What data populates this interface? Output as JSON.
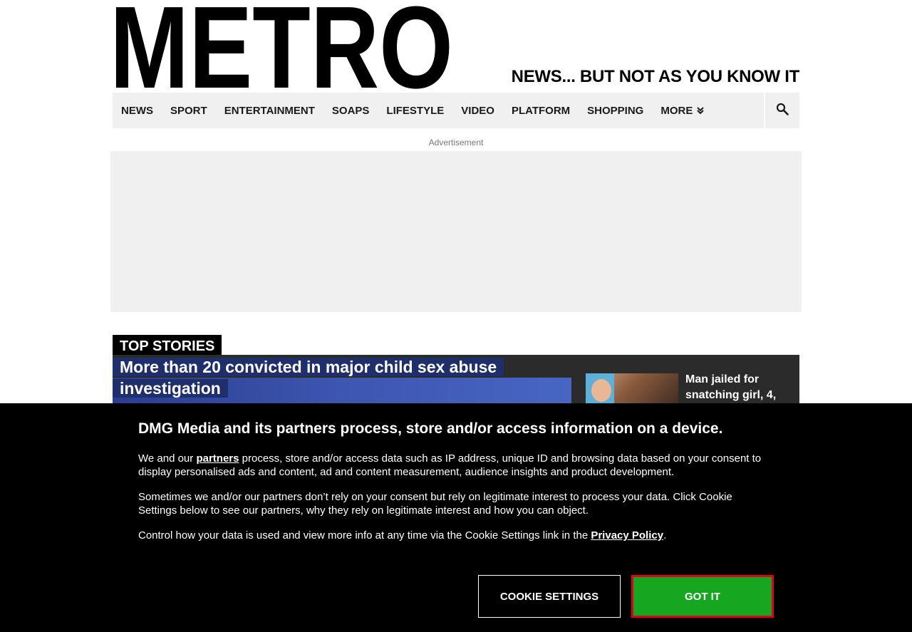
{
  "header": {
    "logo_text": "METRO",
    "tagline": "NEWS... BUT NOT AS YOU KNOW IT"
  },
  "nav": {
    "items": [
      {
        "label": "NEWS"
      },
      {
        "label": "SPORT"
      },
      {
        "label": "ENTERTAINMENT"
      },
      {
        "label": "SOAPS"
      },
      {
        "label": "LIFESTYLE"
      },
      {
        "label": "VIDEO"
      },
      {
        "label": "PLATFORM"
      },
      {
        "label": "SHOPPING"
      },
      {
        "label": "MORE"
      }
    ],
    "more_icon": "double-chevron-down-icon",
    "search_icon": "search-icon"
  },
  "ad": {
    "label": "Advertisement"
  },
  "top_stories": {
    "label": "TOP STORIES",
    "main_headline": "More than 20 convicted in major child sex abuse investigation",
    "side_headline": "Man jailed for snatching girl, 4,"
  },
  "consent": {
    "title": "DMG Media and its partners process, store and/or access information on a device.",
    "p1_before": "We and our ",
    "p1_link": "partners",
    "p1_after": " process, store and/or access data such as IP address, unique ID and browsing data based on your consent to display personalised ads and content, ad and content measurement, audience insights and product development.",
    "p2": "Sometimes we and/or our partners don’t rely on your consent but rely on legitimate interest to process your data. Click Cookie Settings below to see our partners, why they rely on legitimate interest and how you can object.",
    "p3_before": "Control how your data is used and view more info at any time via the Cookie Settings link in the ",
    "p3_link": "Privacy Policy",
    "p3_after": ".",
    "settings_button": "COOKIE SETTINGS",
    "accept_button": "GOT IT"
  },
  "colors": {
    "accept_green": "#16a620",
    "accept_border_red": "#e0001a",
    "nav_bg": "#f0f0f0",
    "consent_bg": "#000000"
  }
}
